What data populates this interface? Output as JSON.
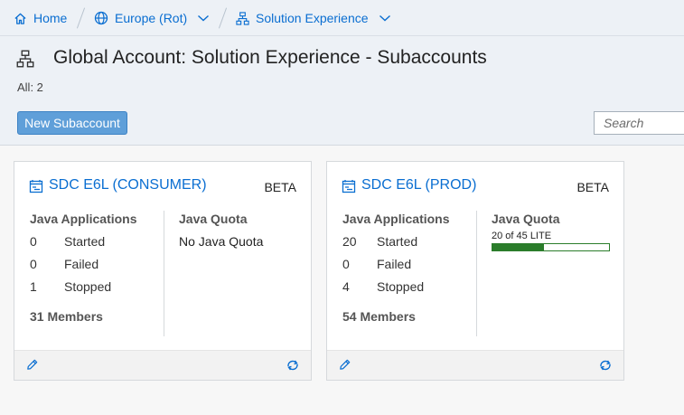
{
  "breadcrumb": {
    "home": "Home",
    "region": "Europe (Rot)",
    "account": "Solution Experience"
  },
  "header": {
    "title": "Global Account: Solution Experience - Subaccounts",
    "count": "All: 2",
    "new_button": "New Subaccount",
    "search_placeholder": "Search"
  },
  "cards": [
    {
      "title": "SDC E6L (CONSUMER)",
      "badge": "BETA",
      "apps_title": "Java Applications",
      "stats": [
        {
          "num": "0",
          "label": "Started"
        },
        {
          "num": "0",
          "label": "Failed"
        },
        {
          "num": "1",
          "label": "Stopped"
        }
      ],
      "members": "31 Members",
      "quota_title": "Java Quota",
      "quota_text": "No Java Quota"
    },
    {
      "title": "SDC E6L (PROD)",
      "badge": "BETA",
      "apps_title": "Java Applications",
      "stats": [
        {
          "num": "20",
          "label": "Started"
        },
        {
          "num": "0",
          "label": "Failed"
        },
        {
          "num": "4",
          "label": "Stopped"
        }
      ],
      "members": "54 Members",
      "quota_title": "Java Quota",
      "quota_caption": "20 of 45 LITE",
      "quota_used": 20,
      "quota_total": 45
    }
  ],
  "icons": {
    "home": "home-icon",
    "globe": "globe-icon",
    "hierarchy": "hierarchy-icon",
    "chevron": "chevron-down-icon",
    "subaccount": "subaccount-icon",
    "edit": "pencil-icon",
    "sync": "sync-icon"
  },
  "colors": {
    "link": "#0a6ed1",
    "button": "#5f9fd9",
    "quota_bar": "#2b7d2b"
  }
}
